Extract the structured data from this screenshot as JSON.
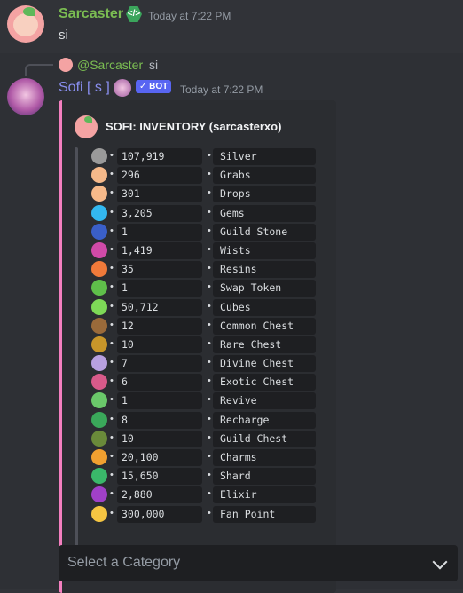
{
  "message1": {
    "author": "Sarcaster",
    "timestamp": "Today at 7:22 PM",
    "text": "si"
  },
  "message2": {
    "reply": {
      "mention": "@Sarcaster",
      "text": "si"
    },
    "author": "Sofi [ s ]",
    "bot_badge": "✓ BOT",
    "timestamp": "Today at 7:22 PM",
    "embed": {
      "title": "SOFI: INVENTORY (sarcasterxo)",
      "accent": "#f47fbf",
      "items": [
        {
          "value": "107,919",
          "label": "Silver",
          "icon": "silver-coin-icon",
          "color": "#9a9a9a"
        },
        {
          "value": "296",
          "label": "Grabs",
          "icon": "grab-hand-icon",
          "color": "#f6b98a"
        },
        {
          "value": "301",
          "label": "Drops",
          "icon": "drop-hand-icon",
          "color": "#f6b98a"
        },
        {
          "value": "3,205",
          "label": "Gems",
          "icon": "gem-icon",
          "color": "#33b8f0"
        },
        {
          "value": "1",
          "label": "Guild Stone",
          "icon": "guild-stone-icon",
          "color": "#3a5fc8"
        },
        {
          "value": "1,419",
          "label": "Wists",
          "icon": "wist-icon",
          "color": "#d04aa8"
        },
        {
          "value": "35",
          "label": "Resins",
          "icon": "resin-icon",
          "color": "#f07a3a"
        },
        {
          "value": "1",
          "label": "Swap Token",
          "icon": "swap-token-icon",
          "color": "#5fbf4a"
        },
        {
          "value": "50,712",
          "label": "Cubes",
          "icon": "cube-icon",
          "color": "#7ed957"
        },
        {
          "value": "12",
          "label": "Common Chest",
          "icon": "common-chest-icon",
          "color": "#9a6a3a"
        },
        {
          "value": "10",
          "label": "Rare Chest",
          "icon": "rare-chest-icon",
          "color": "#c8962a"
        },
        {
          "value": "7",
          "label": "Divine Chest",
          "icon": "divine-chest-icon",
          "color": "#b8a0e0"
        },
        {
          "value": "6",
          "label": "Exotic Chest",
          "icon": "exotic-chest-icon",
          "color": "#d85a8a"
        },
        {
          "value": "1",
          "label": "Revive",
          "icon": "revive-syringe-icon",
          "color": "#6ac86a"
        },
        {
          "value": "8",
          "label": "Recharge",
          "icon": "recharge-battery-icon",
          "color": "#3aa85a"
        },
        {
          "value": "10",
          "label": "Guild Chest",
          "icon": "guild-chest-icon",
          "color": "#6a8a3a"
        },
        {
          "value": "20,100",
          "label": "Charms",
          "icon": "charm-ticket-icon",
          "color": "#f0a030"
        },
        {
          "value": "15,650",
          "label": "Shard",
          "icon": "shard-icon",
          "color": "#3ab86a"
        },
        {
          "value": "2,880",
          "label": "Elixir",
          "icon": "elixir-drop-icon",
          "color": "#a040c8"
        },
        {
          "value": "300,000",
          "label": "Fan Point",
          "icon": "heart-eyes-icon",
          "color": "#f5c542"
        }
      ]
    },
    "select": {
      "placeholder": "Select a Category"
    }
  }
}
